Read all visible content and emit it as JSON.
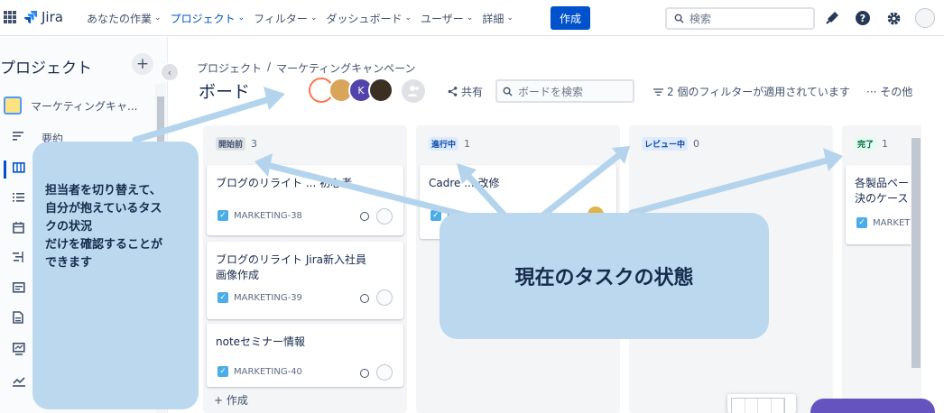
{
  "topnav": {
    "logo": "Jira",
    "items": [
      {
        "label": "あなたの作業",
        "active": false
      },
      {
        "label": "プロジェクト",
        "active": true
      },
      {
        "label": "フィルター",
        "active": false
      },
      {
        "label": "ダッシュボード",
        "active": false
      },
      {
        "label": "ユーザー",
        "active": false
      },
      {
        "label": "詳細",
        "active": false
      }
    ],
    "create_label": "作成",
    "search_placeholder": "検索"
  },
  "sidebar": {
    "title": "プロジェクト",
    "add_label": "+",
    "project_name": "マーケティングキャ...",
    "first_item_label": "要約"
  },
  "main": {
    "breadcrumb": [
      "プロジェクト",
      "/",
      "マーケティングキャンペーン"
    ],
    "title": "ボード",
    "avatar_k": "K",
    "share_label": "共有",
    "board_search_placeholder": "ボードを検索",
    "filter_info": "2 個のフィルターが適用されています",
    "more_label": "··· その他"
  },
  "columns": [
    {
      "status": "開始前",
      "count": "3",
      "cards": [
        {
          "title": "ブログのリライト ... 初心者",
          "key": "MARKETING-38"
        },
        {
          "title": "ブログのリライト Jira新入社員\n画像作成",
          "key": "MARKETING-39"
        },
        {
          "title": "noteセミナー情報",
          "key": "MARKETING-40"
        }
      ],
      "add_issue": "+ 作成"
    },
    {
      "status": "進行中",
      "count": "1",
      "cards": [
        {
          "title": "Cadre ... 改修",
          "key": "M..."
        }
      ]
    },
    {
      "status": "レビュー中",
      "count": "0",
      "cards": []
    },
    {
      "status": "完了",
      "count": "1",
      "cards": [
        {
          "title": "各製品ペー\n決のケース",
          "key": "MARKETI"
        }
      ]
    }
  ],
  "overlays": {
    "left_text": "担当者を切り替えて、\n自分が抱えているタス\nクの状況\nだけを確認することが\nできます",
    "center_text": "現在のタスクの状態"
  },
  "colors": {
    "primary": "#0052cc",
    "callout": "#bbd8ee",
    "arrow": "#b3d4ec",
    "lozenge_todo_bg": "#dfe1e6",
    "lozenge_progress_bg": "#deebff",
    "lozenge_done_bg": "#e3fcef",
    "lozenge_done_fg": "#006644"
  }
}
